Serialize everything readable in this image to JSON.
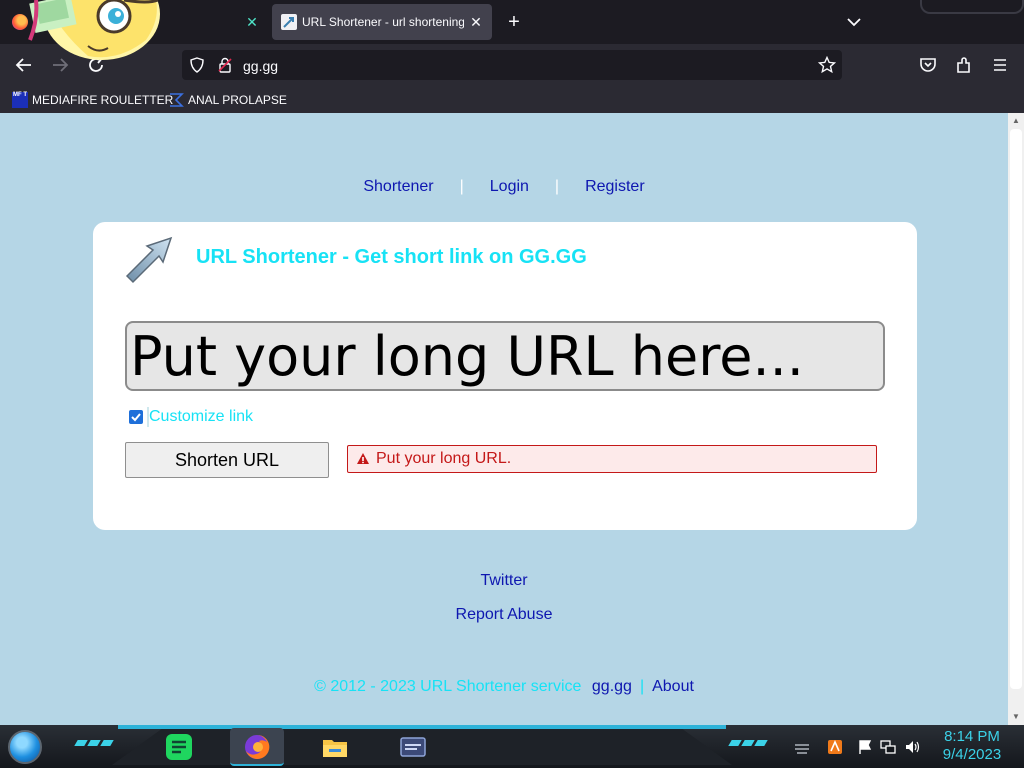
{
  "browser": {
    "tabs": [
      {
        "label": "",
        "close": "✕"
      },
      {
        "label": "URL Shortener - url shortening service",
        "close": "✕"
      }
    ],
    "new_tab": "+",
    "url": "gg.gg",
    "bookmarks": [
      {
        "label": "MEDIAFIRE ROULETTER",
        "icon_text": "MF T"
      },
      {
        "label": "ANAL PROLAPSE"
      }
    ]
  },
  "page": {
    "nav": {
      "shortener": "Shortener",
      "sep": "|",
      "login": "Login",
      "register": "Register"
    },
    "card_title": "URL Shortener - Get short link on GG.GG",
    "url_placeholder": "Put your long URL here...",
    "customize_label": "Customize link",
    "customize_checked": true,
    "shorten_button": "Shorten URL",
    "error_message": "Put your long URL.",
    "footer": {
      "twitter": "Twitter",
      "report_abuse": "Report Abuse",
      "copyright": "© 2012 - 2023 URL Shortener service",
      "site_link": "gg.gg",
      "bar": "|",
      "about": "About"
    }
  },
  "taskbar": {
    "time": "8:14 PM",
    "date": "9/4/2023"
  },
  "colors": {
    "page_bg": "#b5d6e6",
    "accent_cyan": "#17e2f5",
    "link_blue": "#0e17b0",
    "error_red": "#c41818"
  }
}
